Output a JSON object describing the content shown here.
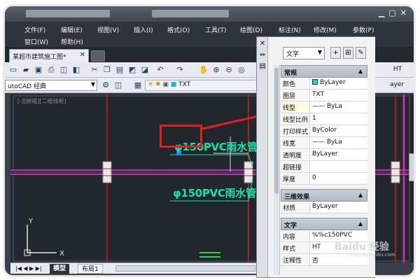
{
  "menu": {
    "row1": [
      "文件(F)",
      "编辑(E)",
      "视图(V)",
      "插入(I)",
      "格式(O)",
      "工具(T)",
      "绘图(D)",
      "标注(N)",
      "修改(M)",
      "参数(P)"
    ],
    "row2": [
      "窗口(W)",
      "帮助(H)"
    ]
  },
  "tabs": {
    "document_tab": "某超市建筑施工图*",
    "close_glyph": "✕"
  },
  "toolbar": {
    "workspace": "utoCAD 经典",
    "layer_value": "TXT",
    "style_right": "HT",
    "layer_right": "ayer"
  },
  "canvas": {
    "viewport_label": "[-][俯视][二维线框]",
    "pipe_label_top": "φ150PVC雨水管",
    "pipe_label_bottom": "φ150PVC雨水管",
    "ucs_y": "Y",
    "ucs_x": "X",
    "colors": {
      "background": "#22262d",
      "pipe_band": "#c6309a",
      "grid_red": "#c0202a",
      "label": "#18e3a5",
      "callout": "#e02020"
    }
  },
  "model_tabs": [
    "模型",
    "布局1"
  ],
  "palette": {
    "strip_icons": [
      "✕",
      "⇔",
      "▤"
    ],
    "object_type": "文字",
    "buttons": [
      "+",
      "⊞",
      "✎"
    ],
    "sections": [
      {
        "title": "常规",
        "rows": [
          {
            "key": "颜色",
            "value": "ByLayer",
            "swatch": "#19d7d7"
          },
          {
            "key": "图层",
            "value": "TXT"
          },
          {
            "key": "线型",
            "value": "—— ByLa"
          },
          {
            "key": "线型比例",
            "value": "1"
          },
          {
            "key": "打印样式",
            "value": "ByColor"
          },
          {
            "key": "线宽",
            "value": "—— ByLa"
          },
          {
            "key": "透明度",
            "value": "ByLayer"
          },
          {
            "key": "超链接",
            "value": ""
          },
          {
            "key": "厚度",
            "value": "0"
          }
        ]
      },
      {
        "title": "三维效果",
        "rows": [
          {
            "key": "材质",
            "value": "ByLayer"
          }
        ]
      },
      {
        "title": "文字",
        "rows": [
          {
            "key": "内容",
            "value": "%%c150PVC"
          },
          {
            "key": "样式",
            "value": "HT"
          },
          {
            "key": "注释性",
            "value": "否"
          }
        ]
      }
    ]
  },
  "watermark": {
    "text": "Baidu 经验",
    "sub": "jingyan.baidu.com"
  }
}
